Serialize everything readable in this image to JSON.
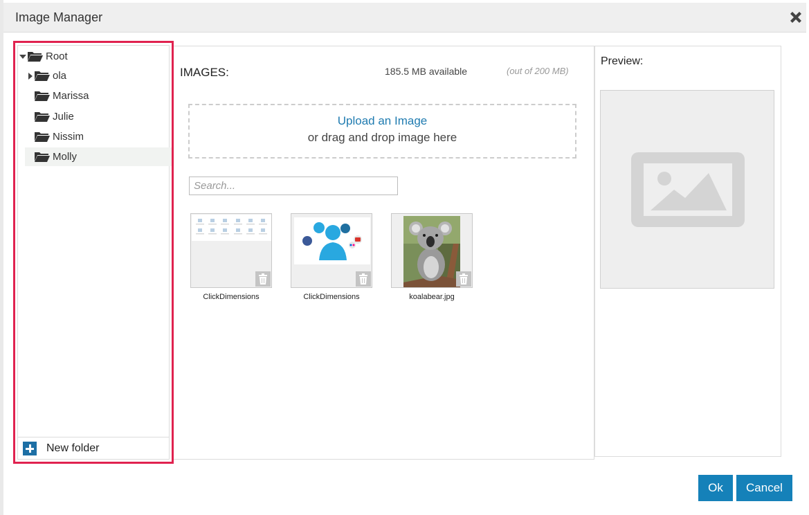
{
  "dialog": {
    "title": "Image Manager"
  },
  "tree": {
    "root": "Root",
    "folders": [
      {
        "label": "ola",
        "has_children": true
      },
      {
        "label": "Marissa",
        "has_children": false
      },
      {
        "label": "Julie",
        "has_children": false
      },
      {
        "label": "Nissim",
        "has_children": false
      },
      {
        "label": "Molly",
        "has_children": false,
        "selected": true
      }
    ],
    "new_folder_label": "New folder"
  },
  "images": {
    "heading": "IMAGES:",
    "available": "185.5 MB available",
    "quota": "(out of 200 MB)",
    "upload_link": "Upload an Image",
    "drag_hint": "or drag and drop image here",
    "search_placeholder": "Search...",
    "items": [
      {
        "caption": "ClickDimensions"
      },
      {
        "caption": "ClickDimensions"
      },
      {
        "caption": "koalabear.jpg"
      }
    ]
  },
  "preview": {
    "label": "Preview:"
  },
  "buttons": {
    "ok": "Ok",
    "cancel": "Cancel"
  },
  "colors": {
    "accent": "#1581b9",
    "highlight_border": "#e0224f",
    "link": "#1f7bb0"
  }
}
